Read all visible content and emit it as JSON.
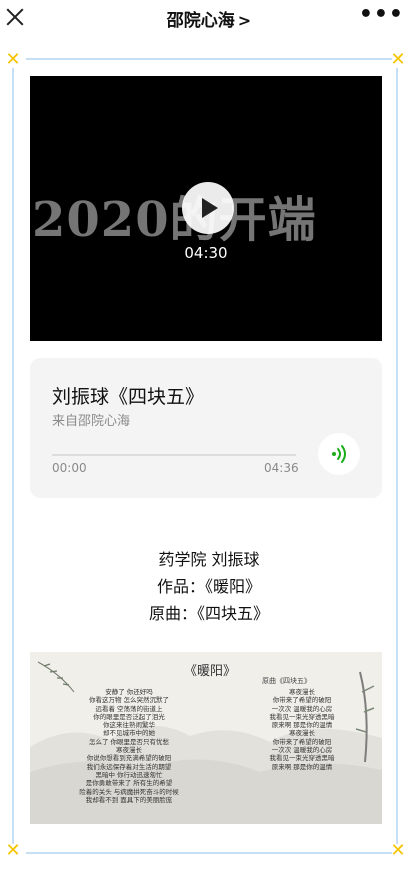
{
  "nav": {
    "title": "邵院心海",
    "chevron": ">",
    "more": "•••"
  },
  "video": {
    "overlay_title": "2020的开端",
    "duration": "04:30"
  },
  "audio": {
    "title": "刘振球《四块五》",
    "source": "来自邵院心海",
    "current_time": "00:00",
    "total_time": "04:36",
    "progress": 0
  },
  "credits": {
    "line1": "药学院  刘振球",
    "line2": "作品：《暖阳》",
    "line3": "原曲：《四块五》"
  },
  "lyrics_image": {
    "heading": "《暖阳》",
    "subhead": "原曲《四块五》",
    "left_lines": [
      "安静了 你还好吗",
      "你看这万物 怎么突然沉默了",
      "远看着 空荡荡的街道上",
      "你的眼里是否泛起了泪光",
      "你这来往熟闹繁华",
      "却不见城市中的她",
      "怎么了 你眼里是否只有忧愁",
      "寒夜漫长",
      "你说你想看到充满希望的破阳",
      "我们永远保存着对生活的期望",
      "黑暗中 你行动迅速匆忙",
      "是你勇敢带来了 所有生的希望",
      "险着的关头 与病魔拼死奋斗的时候",
      "我却看不到 面具下的美丽脸庞"
    ],
    "right_lines": [
      "寒夜漫长",
      "你带来了希望的破阳",
      "一次次 温暖我的心房",
      "我看见一束光穿透黑暗",
      "原来啊 那是你的温情",
      "寒夜漫长",
      "你带来了希望的破阳",
      "一次次 温暖我的心房",
      "我看见一束光穿透黑暗",
      "原来啊 那是你的温情"
    ]
  },
  "colors": {
    "frame_line": "#c7dff4",
    "corner_mark": "#f5c400",
    "audio_accent": "#1aad19"
  }
}
